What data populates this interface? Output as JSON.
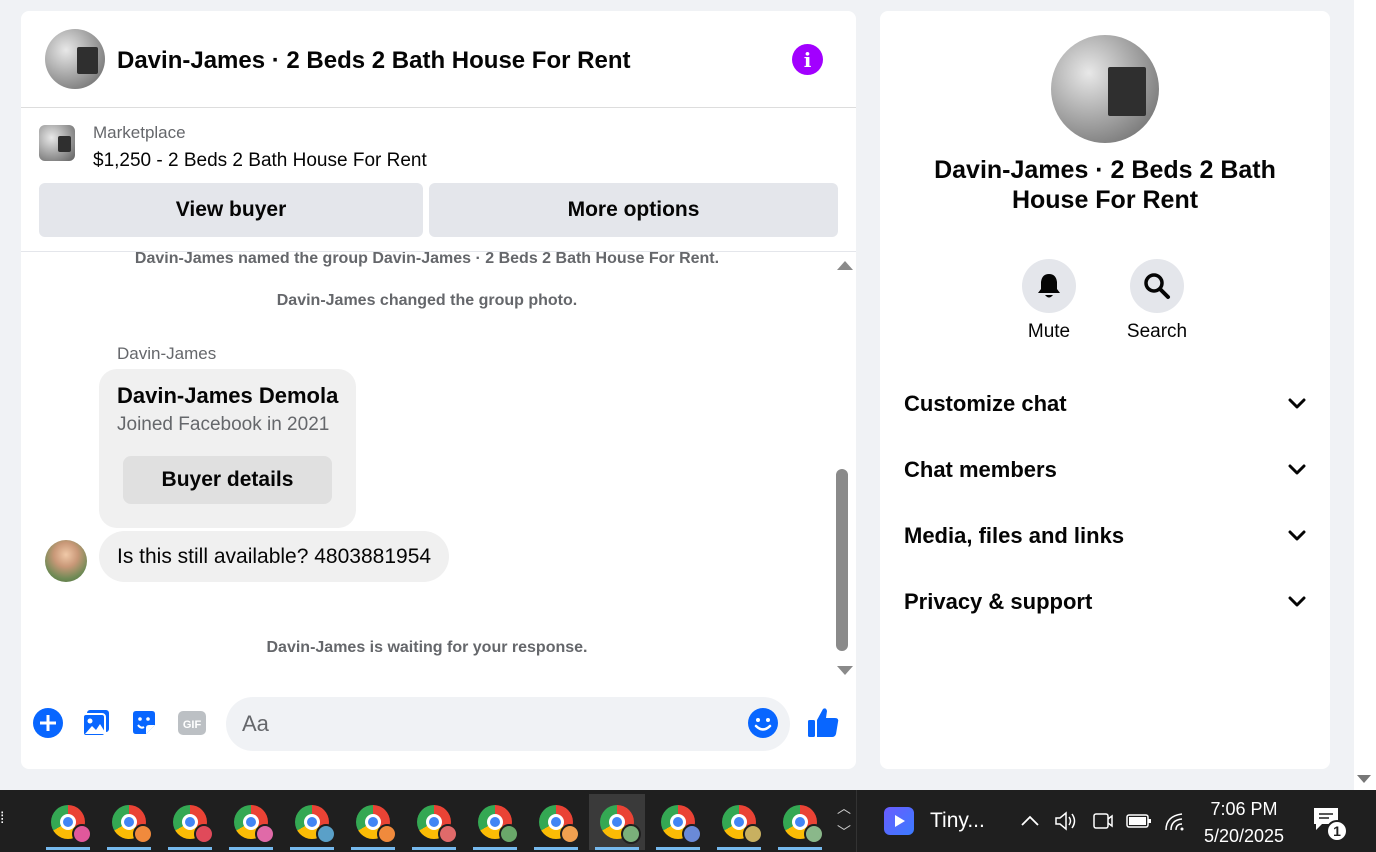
{
  "chat": {
    "title": "Davin-James · 2 Beds 2 Bath House For Rent",
    "marketplace_label": "Marketplace",
    "listing": "$1,250 - 2 Beds 2 Bath House For Rent",
    "view_buyer_label": "View buyer",
    "more_options_label": "More options",
    "messages": {
      "system_1": "Davin-James named the group Davin-James · 2 Beds 2 Bath House For Rent.",
      "system_2": "Davin-James changed the group photo.",
      "sender": "Davin-James",
      "buyer_name": "Davin-James Demola",
      "buyer_joined": "Joined Facebook in 2021",
      "buyer_details_label": "Buyer details",
      "message_text": "Is this still available? 4803881954",
      "waiting_status": "Davin-James is waiting for your response."
    },
    "composer": {
      "placeholder": "Aa",
      "gif_label": "GIF"
    },
    "accent_color": "#0866ff",
    "info_color": "#a200ff"
  },
  "info_panel": {
    "title": "Davin-James · 2 Beds 2 Bath House For Rent",
    "actions": [
      {
        "label": "Mute",
        "icon": "bell-icon"
      },
      {
        "label": "Search",
        "icon": "search-icon"
      }
    ],
    "sections": [
      {
        "label": "Customize chat"
      },
      {
        "label": "Chat members"
      },
      {
        "label": "Media, files and links"
      },
      {
        "label": "Privacy & support"
      }
    ]
  },
  "taskbar": {
    "apps": [
      {
        "icon": "chrome-icon",
        "profile_color": "#e0589b"
      },
      {
        "icon": "chrome-icon",
        "profile_color": "#f08a3c"
      },
      {
        "icon": "chrome-icon",
        "profile_color": "#e04a5a"
      },
      {
        "icon": "chrome-icon",
        "profile_color": "#e06aa8"
      },
      {
        "icon": "chrome-icon",
        "profile_color": "#5aa0c8"
      },
      {
        "icon": "chrome-icon",
        "profile_color": "#f08a3c"
      },
      {
        "icon": "chrome-icon",
        "profile_color": "#e06a6a"
      },
      {
        "icon": "chrome-icon",
        "profile_color": "#6aa86a"
      },
      {
        "icon": "chrome-icon",
        "profile_color": "#f0a050"
      },
      {
        "icon": "chrome-icon",
        "profile_color": "#7ab07a"
      },
      {
        "icon": "chrome-icon",
        "profile_color": "#6a8ad8"
      },
      {
        "icon": "chrome-icon",
        "profile_color": "#c8b060"
      },
      {
        "icon": "chrome-icon",
        "profile_color": "#8ab88a"
      }
    ],
    "tiny_app_label": "Tiny...",
    "time": "7:06 PM",
    "date": "5/20/2025",
    "notification_count": "1"
  }
}
